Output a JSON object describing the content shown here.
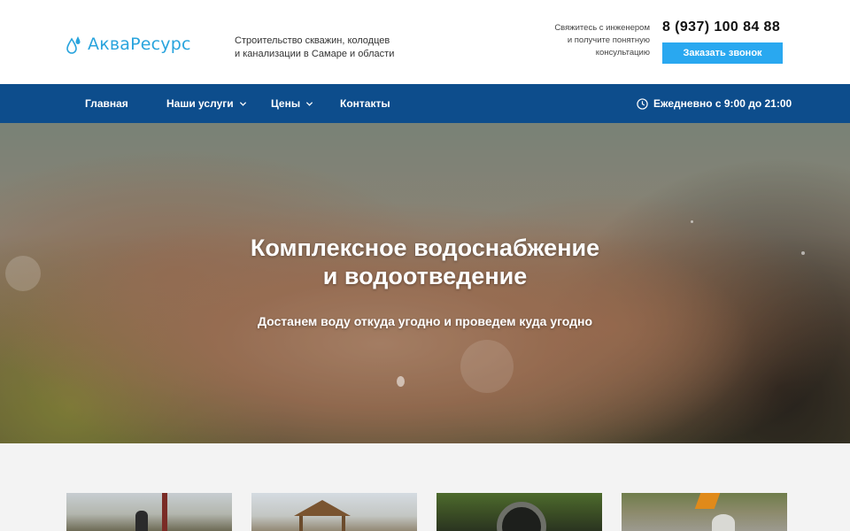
{
  "header": {
    "logo_text": "АкваРесурс",
    "tagline_line1": "Строительство скважин, колодцев",
    "tagline_line2": "и канализации в Самаре и области",
    "contact_note_line1": "Свяжитесь с инженером",
    "contact_note_line2": "и получите понятную",
    "contact_note_line3": "консультацию",
    "phone": "8 (937) 100 84 88",
    "callback_label": "Заказать звонок"
  },
  "nav": {
    "items": [
      {
        "label": "Главная",
        "dropdown": false
      },
      {
        "label": "Наши услуги",
        "dropdown": true
      },
      {
        "label": "Цены",
        "dropdown": true
      },
      {
        "label": "Контакты",
        "dropdown": false
      }
    ],
    "hours": "Ежедневно с 9:00 до 21:00"
  },
  "hero": {
    "title_line1": "Комплексное водоснабжение",
    "title_line2": "и водоотведение",
    "subtitle": "Достанем воду откуда угодно и проведем куда угодно"
  },
  "colors": {
    "brand": "#29a4dd",
    "nav_bg": "#0d4d8c",
    "button_bg": "#29a8f0"
  },
  "icons": {
    "logo": "water-drops-icon",
    "dropdown": "chevron-down-icon",
    "hours": "clock-icon"
  }
}
